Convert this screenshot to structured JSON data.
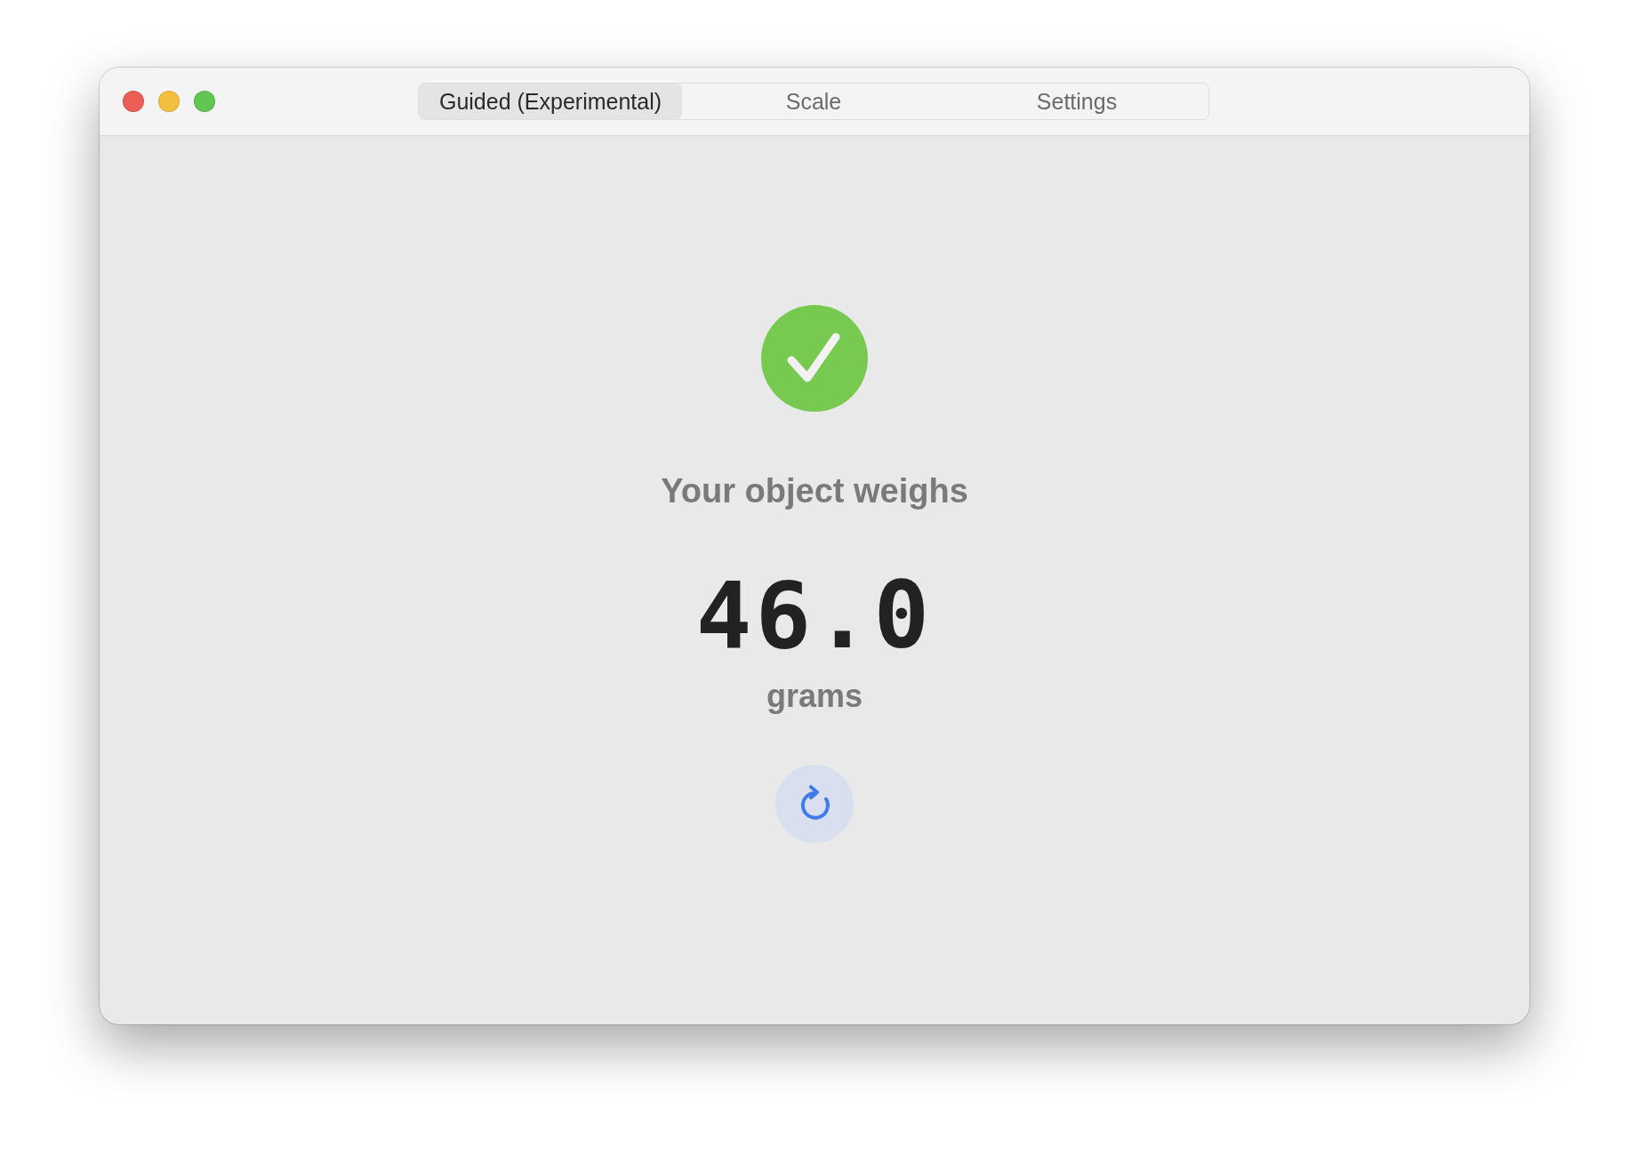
{
  "window": {
    "tabs": [
      {
        "label": "Guided (Experimental)",
        "selected": true
      },
      {
        "label": "Scale",
        "selected": false
      },
      {
        "label": "Settings",
        "selected": false
      }
    ]
  },
  "result": {
    "complete": true,
    "heading": "Your object weighs",
    "value": "46.0",
    "unit": "grams"
  }
}
